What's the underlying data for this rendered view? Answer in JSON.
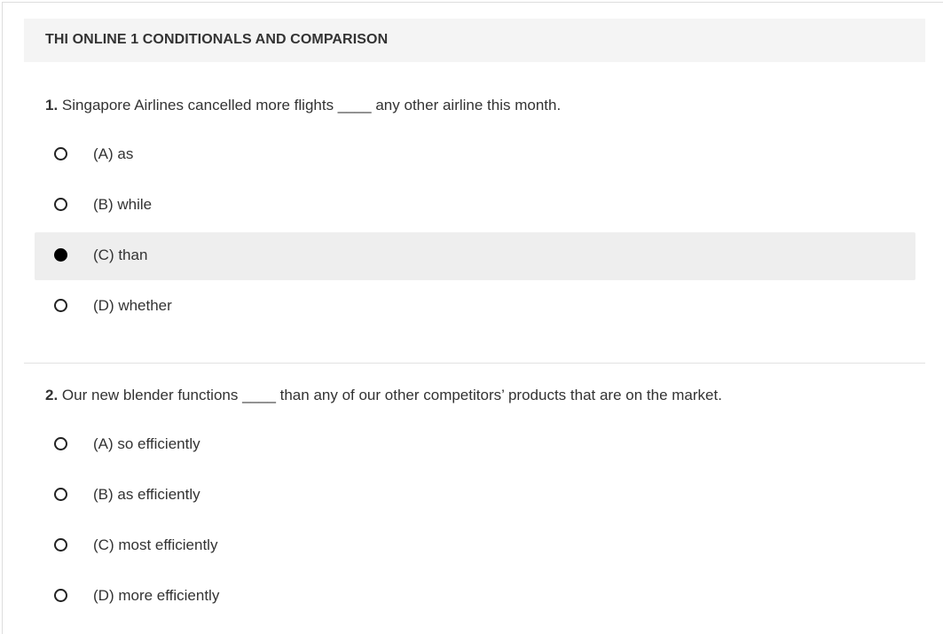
{
  "header": {
    "title": "THI ONLINE 1 CONDITIONALS AND COMPARISON"
  },
  "questions": [
    {
      "number": "1.",
      "text": "Singapore Airlines cancelled more flights ____ any other airline this month.",
      "options": [
        {
          "label": "(A) as",
          "selected": false
        },
        {
          "label": "(B) while",
          "selected": false
        },
        {
          "label": "(C) than",
          "selected": true
        },
        {
          "label": "(D) whether",
          "selected": false
        }
      ]
    },
    {
      "number": "2.",
      "text": "Our new blender functions ____ than any of our other competitors’ products that are on the market.",
      "options": [
        {
          "label": "(A) so efficiently",
          "selected": false
        },
        {
          "label": "(B) as efficiently",
          "selected": false
        },
        {
          "label": "(C) most efficiently",
          "selected": false
        },
        {
          "label": "(D) more efficiently",
          "selected": false
        }
      ]
    }
  ]
}
